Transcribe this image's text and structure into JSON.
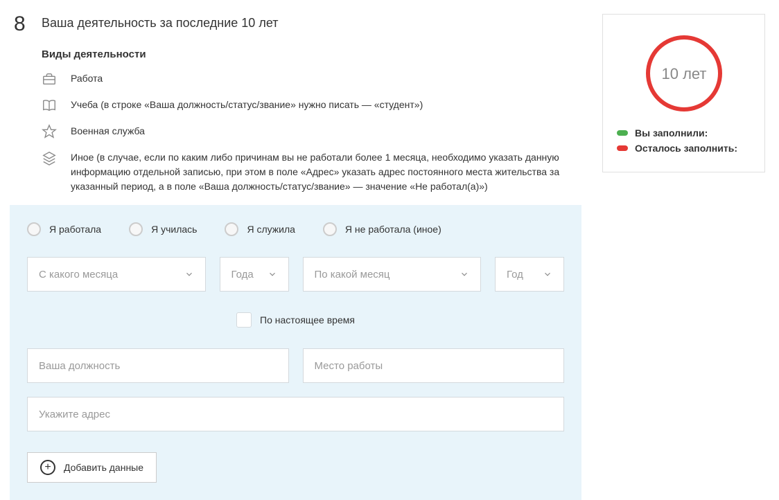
{
  "section": {
    "number": "8",
    "title": "Ваша деятельность за последние 10 лет",
    "subtitle": "Виды деятельности"
  },
  "activities": {
    "work": "Работа",
    "study": "Учеба (в строке «Ваша должность/статус/звание» нужно писать — «студент»)",
    "military": "Военная служба",
    "other": "Иное (в случае, если по каким либо причинам вы не работали более 1 месяца, необходимо указать данную информацию отдельной записью, при этом в поле «Адрес» указать адрес постоянного места жительства за указанный период, а в поле «Ваша должность/статус/звание» — значение «Не работал(а)»)"
  },
  "form": {
    "radios": {
      "worked": "Я работала",
      "studied": "Я училась",
      "served": "Я служила",
      "notworked": "Я не работала (иное)"
    },
    "selects": {
      "from_month": "С какого месяца",
      "from_year": "Года",
      "to_month": "По какой месяц",
      "to_year": "Год"
    },
    "present_label": "По настоящее время",
    "inputs": {
      "position": "Ваша должность",
      "workplace": "Место работы",
      "address": "Укажите адрес"
    },
    "add_btn": "Добавить данные"
  },
  "sidebar": {
    "circle_label": "10 лет",
    "legend": {
      "filled": "Вы заполнили:",
      "remaining": "Осталось заполнить:"
    }
  }
}
